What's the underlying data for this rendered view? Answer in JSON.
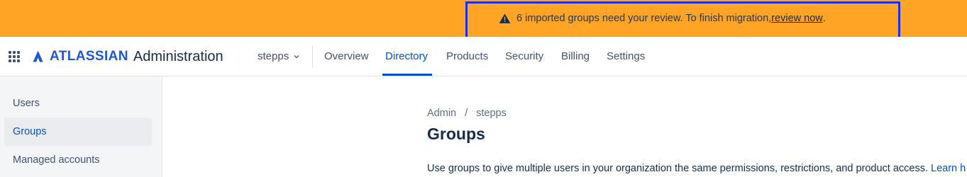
{
  "banner": {
    "icon": "warning-icon",
    "message": "6 imported groups need your review. To finish migration, ",
    "link": "review now",
    "suffix": ".",
    "background": "#FFA424"
  },
  "header": {
    "app_switcher_icon": "grid-icon",
    "logo_word": "ATLASSIAN",
    "logo_product": "Administration",
    "org": "stepps",
    "tabs": [
      {
        "label": "Overview",
        "active": false
      },
      {
        "label": "Directory",
        "active": true
      },
      {
        "label": "Products",
        "active": false
      },
      {
        "label": "Security",
        "active": false
      },
      {
        "label": "Billing",
        "active": false
      },
      {
        "label": "Settings",
        "active": false
      }
    ]
  },
  "sidebar": {
    "items": [
      {
        "label": "Users",
        "active": false
      },
      {
        "label": "Groups",
        "active": true
      },
      {
        "label": "Managed accounts",
        "active": false
      }
    ]
  },
  "main": {
    "breadcrumb": [
      "Admin",
      "stepps"
    ],
    "breadcrumb_separator": "/",
    "title": "Groups",
    "description": "Use groups to give multiple users in your organization the same permissions, restrictions, and product access. ",
    "learn_more": "Learn h"
  },
  "colors": {
    "accent": "#0052CC",
    "highlight": "#1B2EE8"
  }
}
